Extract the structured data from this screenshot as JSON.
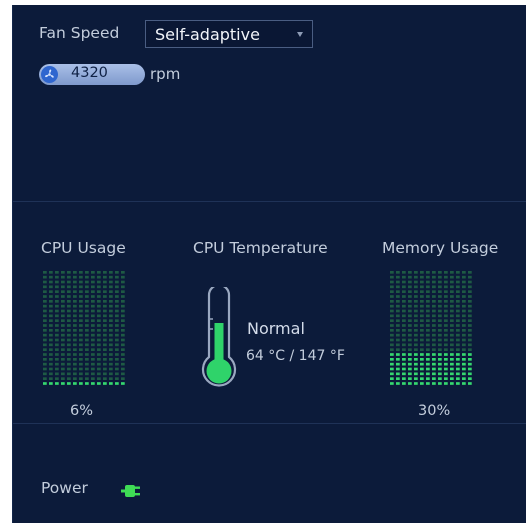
{
  "fan": {
    "label": "Fan Speed",
    "mode_value": "Self-adaptive",
    "rpm_value": "4320",
    "rpm_unit": "rpm"
  },
  "cpu_usage": {
    "label": "CPU Usage",
    "percent_text": "6%",
    "percent_value": 6
  },
  "cpu_temperature": {
    "label": "CPU Temperature",
    "status": "Normal",
    "value_text": "64 °C / 147 °F"
  },
  "memory_usage": {
    "label": "Memory Usage",
    "percent_text": "30%",
    "percent_value": 30
  },
  "power": {
    "label": "Power",
    "icon": "power-plug-icon"
  },
  "colors": {
    "panel_bg": "#0c1b3a",
    "meter_on": "#35d86f",
    "meter_off": "#1e5a44",
    "pill_fill": "#8aa4d6",
    "fan_icon": "#2f66cf",
    "power_icon": "#3fdc55"
  }
}
